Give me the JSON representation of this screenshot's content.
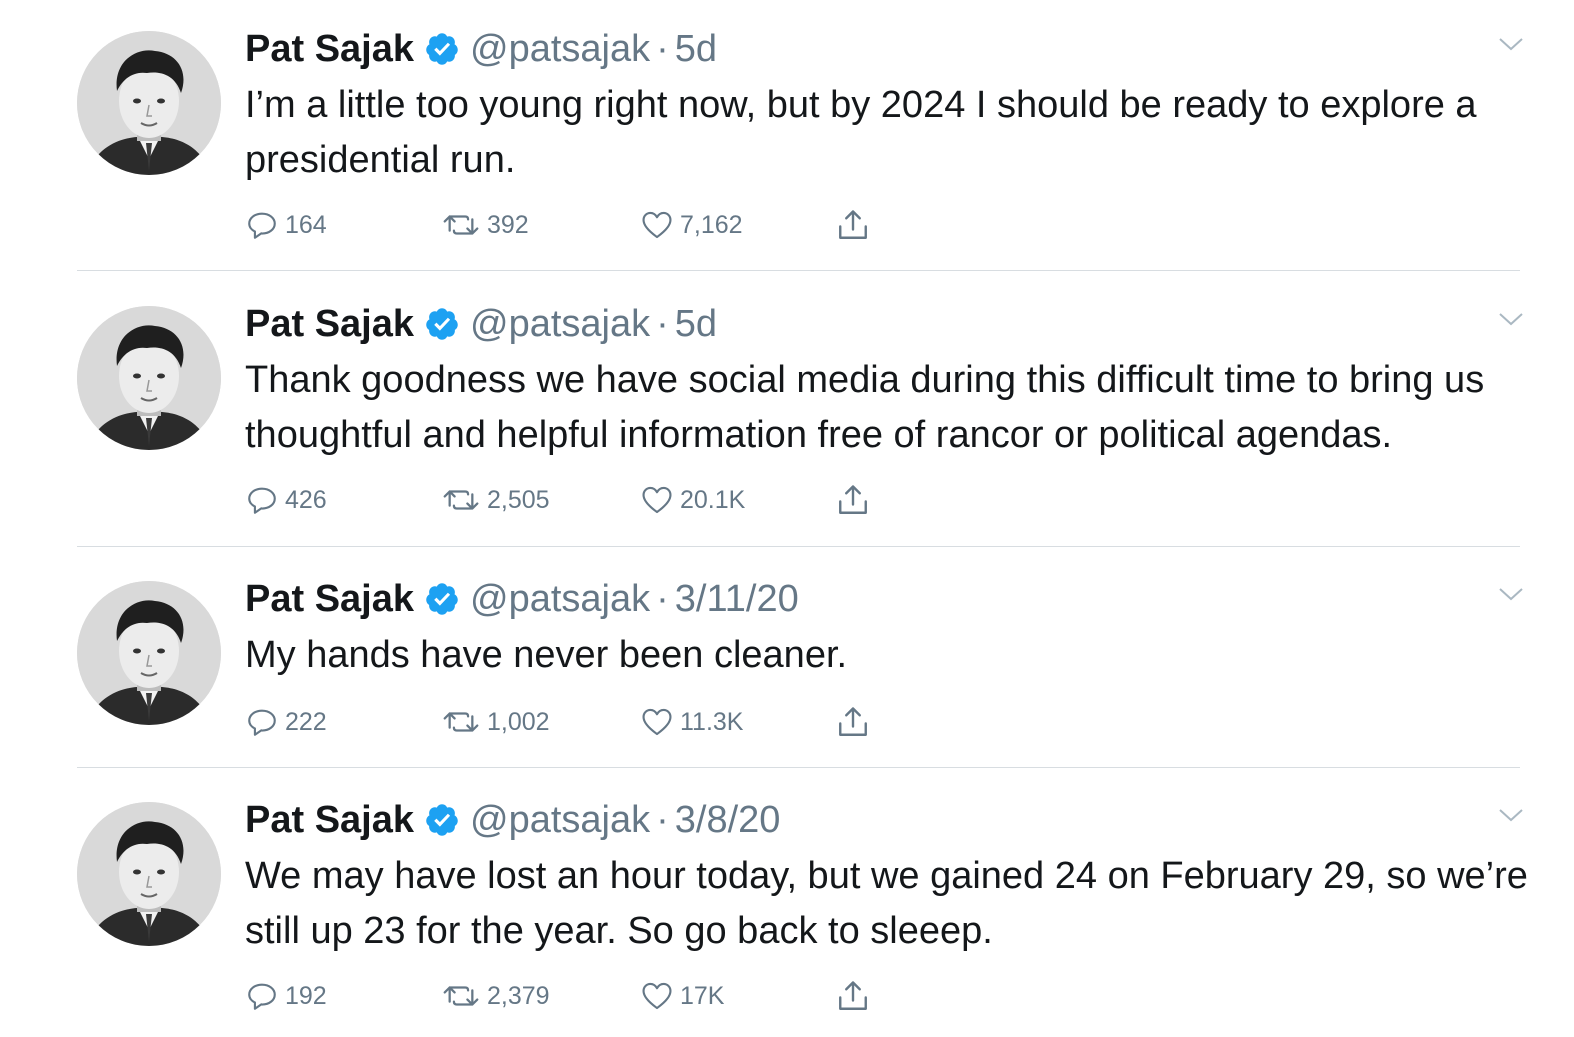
{
  "colors": {
    "text": "#14171a",
    "secondary": "#657786",
    "verified": "#1da1f2",
    "divider": "#d8dde1"
  },
  "icons": {
    "reply": "reply-icon",
    "retweet": "retweet-icon",
    "like": "heart-icon",
    "share": "share-icon",
    "verified": "verified-badge-icon",
    "caret": "chevron-down-icon"
  },
  "tweets": [
    {
      "name": "Pat Sajak",
      "handle": "@patsajak",
      "dot": "·",
      "time": "5d",
      "text": "I’m a little too young right now, but by 2024 I should be ready to explore a presidential run.",
      "replies": "164",
      "retweets": "392",
      "likes": "7,162"
    },
    {
      "name": "Pat Sajak",
      "handle": "@patsajak",
      "dot": "·",
      "time": "5d",
      "text": "Thank goodness we have social media during this difficult time to bring us thoughtful and helpful information free of rancor or political agendas.",
      "replies": "426",
      "retweets": "2,505",
      "likes": "20.1K"
    },
    {
      "name": "Pat Sajak",
      "handle": "@patsajak",
      "dot": "·",
      "time": "3/11/20",
      "text": "My hands have never been cleaner.",
      "replies": "222",
      "retweets": "1,002",
      "likes": "11.3K"
    },
    {
      "name": "Pat Sajak",
      "handle": "@patsajak",
      "dot": "·",
      "time": "3/8/20",
      "text": "We may have lost an hour today, but we gained 24 on February 29, so we’re still up 23 for the year. So go back to sleeep.",
      "replies": "192",
      "retweets": "2,379",
      "likes": "17K"
    }
  ]
}
